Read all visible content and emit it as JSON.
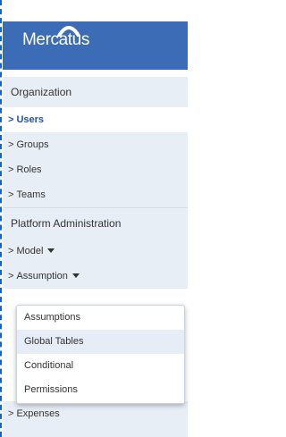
{
  "brand": {
    "name": "Mercatus",
    "color": "#3d6cb6"
  },
  "nav": {
    "sections": [
      {
        "title": "Organization",
        "items": [
          {
            "label": "Users",
            "active": true
          },
          {
            "label": "Groups"
          },
          {
            "label": "Roles"
          },
          {
            "label": "Teams"
          }
        ]
      },
      {
        "title": "Platform Administration",
        "items": [
          {
            "label": "Model",
            "has_caret": true
          },
          {
            "label": "Assumption",
            "has_caret": true
          }
        ]
      }
    ],
    "trailing_item": "Expenses",
    "arrow_glyph": ">"
  },
  "dropdown": {
    "items": [
      "Assumptions",
      "Global Tables",
      "Conditional",
      "Permissions"
    ],
    "hovered": "Global Tables"
  }
}
